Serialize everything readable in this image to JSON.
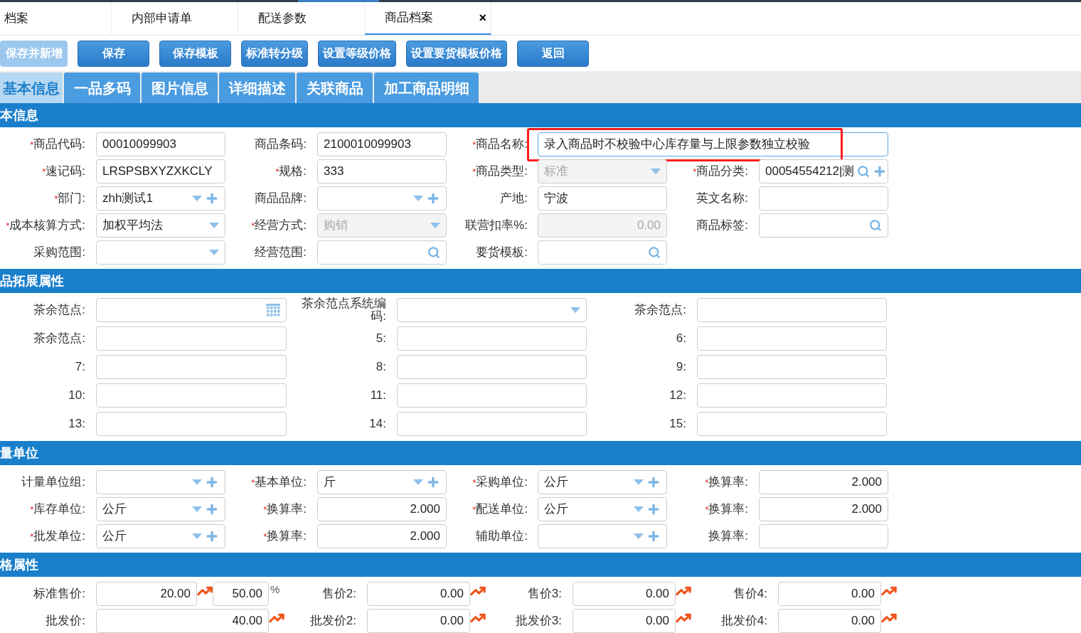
{
  "top_tabs": [
    {
      "label": "档案",
      "selected": false
    },
    {
      "label": "内部申请单",
      "selected": false
    },
    {
      "label": "配送参数",
      "selected": false
    },
    {
      "label": "商品档案",
      "selected": true,
      "close": "×"
    }
  ],
  "toolbar": [
    {
      "label": "保存并新增",
      "disabled": true
    },
    {
      "label": "保存",
      "disabled": false
    },
    {
      "label": "保存模板",
      "disabled": false
    },
    {
      "label": "标准转分级",
      "disabled": false
    },
    {
      "label": "设置等级价格",
      "disabled": false
    },
    {
      "label": "设置要货模板价格",
      "disabled": false
    },
    {
      "label": "返回",
      "disabled": false
    }
  ],
  "sub_tabs": [
    {
      "label": "基本信息",
      "selected": true
    },
    {
      "label": "一品多码",
      "selected": false
    },
    {
      "label": "图片信息",
      "selected": false
    },
    {
      "label": "详细描述",
      "selected": false
    },
    {
      "label": "关联商品",
      "selected": false
    },
    {
      "label": "加工商品明细",
      "selected": false
    }
  ],
  "sections": [
    {
      "kind": "grid4",
      "title": "本信息",
      "fields": [
        {
          "label": "商品代码:",
          "required_mark": "*",
          "kind": "text",
          "value": "00010099903"
        },
        {
          "label": "商品条码:",
          "kind": "text",
          "value": "2100010099903"
        },
        {
          "label": "商品名称:",
          "required_mark": "*",
          "kind": "text",
          "value": "录入商品时不校验中心库存量与上限参数独立校验",
          "focused": true,
          "annotated": true
        },
        {
          "kind": "none"
        },
        {
          "label": "速记码:",
          "required_mark": "*",
          "kind": "text",
          "value": "LRSPSBXYZXKCLY"
        },
        {
          "label": "规格:",
          "required_mark": "*",
          "kind": "text",
          "value": "333"
        },
        {
          "label": "商品类型:",
          "required_mark": "*",
          "kind": "select",
          "value": "标准",
          "disabled": true
        },
        {
          "label": "商品分类:",
          "required_mark": "*",
          "kind": "search_add",
          "value": "00054554212|测"
        },
        {
          "label": "部门:",
          "required_mark": "*",
          "kind": "select_add",
          "value": "zhh测试1"
        },
        {
          "label": "商品品牌:",
          "kind": "select_add"
        },
        {
          "label": "产地:",
          "kind": "text",
          "value": "宁波"
        },
        {
          "label": "英文名称:",
          "kind": "text"
        },
        {
          "label": "成本核算方式:",
          "required_mark": "*",
          "kind": "select",
          "value": "加权平均法"
        },
        {
          "label": "经营方式:",
          "required_mark": "*",
          "kind": "select",
          "value": "购销",
          "disabled": true
        },
        {
          "label": "联营扣率%:",
          "kind": "number",
          "value": "0.00",
          "disabled": true
        },
        {
          "label": "商品标签:",
          "kind": "search"
        },
        {
          "label": "采购范围:",
          "kind": "select"
        },
        {
          "label": "经营范围:",
          "kind": "search"
        },
        {
          "label": "要货模板:",
          "kind": "search"
        }
      ]
    },
    {
      "kind": "grid3",
      "title": "品拓展属性",
      "fields": [
        {
          "label": "茶余范点:",
          "kind": "calendar"
        },
        {
          "label": "茶余范点系统编码:",
          "kind": "select"
        },
        {
          "label": "茶余范点:",
          "kind": "text"
        },
        {
          "label": "茶余范点:",
          "kind": "text"
        },
        {
          "label": "5:",
          "kind": "text"
        },
        {
          "label": "6:",
          "kind": "text"
        },
        {
          "label": "7:",
          "kind": "text"
        },
        {
          "label": "8:",
          "kind": "text"
        },
        {
          "label": "9:",
          "kind": "text"
        },
        {
          "label": "10:",
          "kind": "text"
        },
        {
          "label": "11:",
          "kind": "text"
        },
        {
          "label": "12:",
          "kind": "text"
        },
        {
          "label": "13:",
          "kind": "text"
        },
        {
          "label": "14:",
          "kind": "text"
        },
        {
          "label": "15:",
          "kind": "text"
        }
      ]
    },
    {
      "kind": "grid4",
      "title": "量单位",
      "fields": [
        {
          "label": "计量单位组:",
          "kind": "select_add"
        },
        {
          "label": "基本单位:",
          "required_mark": "*",
          "kind": "select_add",
          "value": "斤"
        },
        {
          "label": "采购单位:",
          "required_mark": "*",
          "kind": "select_add",
          "value": "公斤"
        },
        {
          "label": "换算率:",
          "required_mark": "*",
          "kind": "number",
          "value": "2.000"
        },
        {
          "label": "库存单位:",
          "required_mark": "*",
          "kind": "select_add",
          "value": "公斤"
        },
        {
          "label": "换算率:",
          "required_mark": "*",
          "kind": "number",
          "value": "2.000"
        },
        {
          "label": "配送单位:",
          "required_mark": "*",
          "kind": "select_add",
          "value": "公斤"
        },
        {
          "label": "换算率:",
          "required_mark": "*",
          "kind": "number",
          "value": "2.000"
        },
        {
          "label": "批发单位:",
          "required_mark": "*",
          "kind": "select_add",
          "value": "公斤"
        },
        {
          "label": "换算率:",
          "required_mark": "*",
          "kind": "number",
          "value": "2.000"
        },
        {
          "label": "辅助单位:",
          "kind": "select_add"
        },
        {
          "label": "换算率:",
          "kind": "number"
        }
      ]
    },
    {
      "kind": "price",
      "title": "格属性",
      "fields": [
        {
          "label": "标准售价:",
          "kind": "price",
          "value": "20.00",
          "extra": {
            "value": "50.00",
            "unit": "%"
          }
        },
        {
          "label": "售价2:",
          "kind": "price",
          "value": "0.00"
        },
        {
          "label": "售价3:",
          "kind": "price",
          "value": "0.00"
        },
        {
          "label": "售价4:",
          "kind": "price",
          "value": "0.00"
        },
        {
          "label": "批发价:",
          "kind": "price",
          "value": "40.00"
        },
        {
          "label": "批发价2:",
          "kind": "price",
          "value": "0.00"
        },
        {
          "label": "批发价3:",
          "kind": "price",
          "value": "0.00"
        },
        {
          "label": "批发价4:",
          "kind": "price",
          "value": "0.00"
        }
      ]
    }
  ]
}
